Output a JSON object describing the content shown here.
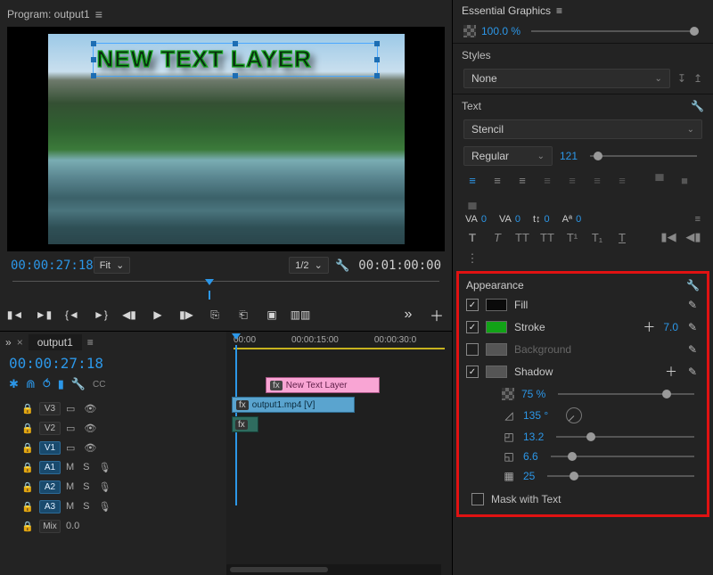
{
  "program": {
    "title": "Program: output1",
    "overlay_text": "NEW TEXT LAYER",
    "timecode_current": "00:00:27:18",
    "timecode_total": "00:01:00:00",
    "fit_label": "Fit",
    "res_label": "1/2"
  },
  "timeline": {
    "tab_label": "output1",
    "timecode": "00:00:27:18",
    "ruler": [
      "00:00",
      "00:00:15:00",
      "00:00:30:0"
    ],
    "tracks": [
      {
        "id": "V3",
        "active": false,
        "kind": "video"
      },
      {
        "id": "V2",
        "active": false,
        "kind": "video"
      },
      {
        "id": "V1",
        "active": true,
        "kind": "video"
      },
      {
        "id": "A1",
        "active": true,
        "kind": "audio"
      },
      {
        "id": "A2",
        "active": true,
        "kind": "audio"
      },
      {
        "id": "A3",
        "active": true,
        "kind": "audio"
      },
      {
        "id": "Mix",
        "active": false,
        "kind": "mix"
      }
    ],
    "clip_text_layer": "New Text Layer",
    "clip_video": "output1.mp4 [V]",
    "fx_label": "fx",
    "mix_value": "0.0",
    "toggle_m": "M",
    "toggle_s": "S"
  },
  "right": {
    "panel_title": "Essential Graphics",
    "opacity_value": "100.0 %",
    "styles_label": "Styles",
    "styles_value": "None",
    "text_label": "Text",
    "font_name": "Stencil",
    "font_style": "Regular",
    "font_size": "121",
    "kern_label": "VA",
    "kern_val": "0",
    "tracking_label": "VA",
    "tracking_val": "0",
    "leading_val": "0",
    "baseline_val": "0",
    "typo_letters": {
      "bold": "T",
      "italic": "T",
      "tt1": "TT",
      "tt2": "TT",
      "sup": "T¹",
      "sub": "T₁",
      "und": "T"
    }
  },
  "appearance": {
    "header": "Appearance",
    "fill_label": "Fill",
    "stroke_label": "Stroke",
    "stroke_width": "7.0",
    "background_label": "Background",
    "shadow_label": "Shadow",
    "shadow_opacity": "75 %",
    "shadow_angle": "135 °",
    "shadow_distance": "13.2",
    "shadow_size": "6.6",
    "shadow_blur": "25",
    "mask_label": "Mask with Text"
  },
  "ss_label": "S S"
}
